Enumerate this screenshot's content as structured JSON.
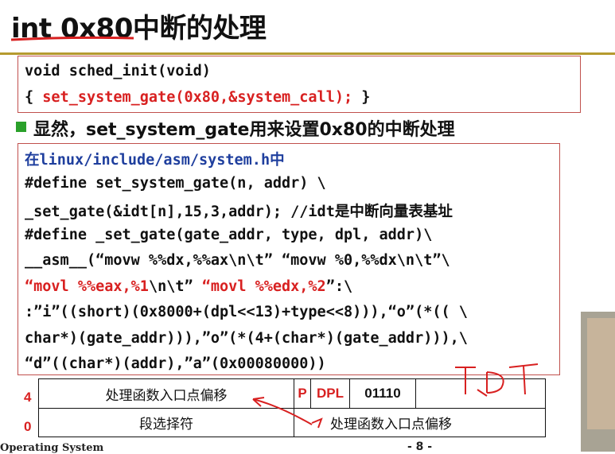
{
  "title": "int 0x80中断的处理",
  "box1": {
    "line1": "void sched_init(void)",
    "line2_open": "{ ",
    "line2_call": "set_system_gate(0x80,&system_call);",
    "line2_close": " }"
  },
  "bullet": "显然，set_system_gate用来设置0x80的中断处理",
  "box2": {
    "line1": "在linux/include/asm/system.h中",
    "line2": "#define set_system_gate(n, addr) \\",
    "line3": "_set_gate(&idt[n],15,3,addr); //idt是中断向量表基址",
    "line4": "#define _set_gate(gate_addr, type, dpl, addr)\\",
    "line5": "__asm__(“movw %%dx,%%ax\\n\\t” “movw %0,%%dx\\n\\t”\\",
    "line6a": "“movl %%eax,%1",
    "line6b": "\\n\\t” ",
    "line6c": "“movl %%edx,%2",
    "line6d": "”:\\",
    "line7": ":”i”((short)(0x8000+(dpl<<13)+type<<8))),“o”(*(( \\",
    "line8": "char*)(gate_addr))),”o”(*(4+(char*)(gate_addr))),\\",
    "line9": "“d”((char*)(addr),”a”(0x00080000))"
  },
  "table": {
    "row_top_num": "4",
    "row_bottom_num": "0",
    "cell_offset_high": "处理函数入口点偏移",
    "cell_p": "P",
    "cell_dpl": "DPL",
    "cell_type": "01110",
    "cell_selector": "段选择符",
    "cell_offset_low": "处理函数入口点偏移"
  },
  "handwriting": "IDT",
  "footer": "Operating System",
  "page_number": "- 8 -",
  "colors": {
    "accent_red": "#d82020",
    "rule": "#b59a2e",
    "bullet": "#2aa02a"
  }
}
